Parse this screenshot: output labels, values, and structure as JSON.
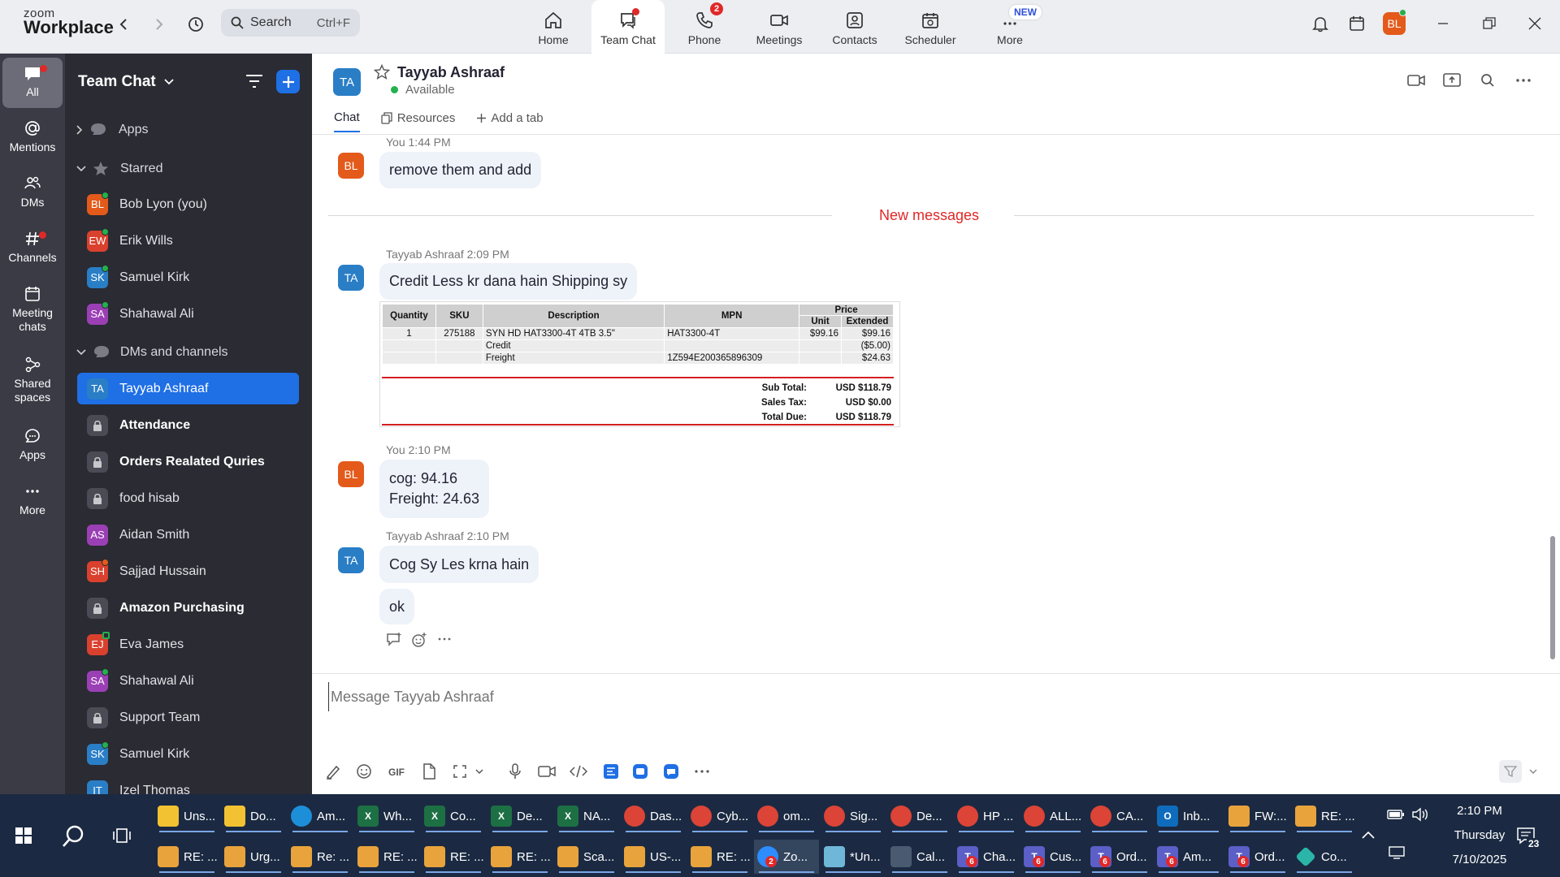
{
  "app": {
    "logo_line1": "zoom",
    "logo_line2": "Workplace"
  },
  "search": {
    "label": "Search",
    "shortcut": "Ctrl+F"
  },
  "tabs": [
    {
      "label": "Home"
    },
    {
      "label": "Team Chat"
    },
    {
      "label": "Phone",
      "badge": "2"
    },
    {
      "label": "Meetings"
    },
    {
      "label": "Contacts"
    },
    {
      "label": "Scheduler"
    },
    {
      "label": "More",
      "tag": "NEW"
    }
  ],
  "user": {
    "initials": "BL"
  },
  "rail": [
    {
      "label": "All"
    },
    {
      "label": "Mentions"
    },
    {
      "label": "DMs"
    },
    {
      "label": "Channels"
    },
    {
      "label": "Meeting chats"
    },
    {
      "label": "Shared spaces"
    },
    {
      "label": "Apps"
    },
    {
      "label": "More"
    }
  ],
  "sidebar": {
    "title": "Team Chat",
    "sections": {
      "apps": "Apps",
      "starred": "Starred",
      "dms": "DMs and channels"
    },
    "starred": [
      {
        "initials": "BL",
        "name": "Bob Lyon (you)"
      },
      {
        "initials": "EW",
        "name": "Erik Wills"
      },
      {
        "initials": "SK",
        "name": "Samuel Kirk"
      },
      {
        "initials": "SA",
        "name": "Shahawal Ali"
      }
    ],
    "channels": [
      {
        "initials": "TA",
        "name": "Tayyab Ashraaf"
      },
      {
        "name": "Attendance"
      },
      {
        "name": "Orders Realated Quries"
      },
      {
        "name": "food hisab"
      },
      {
        "initials": "AS",
        "name": "Aidan Smith"
      },
      {
        "initials": "SH",
        "name": "Sajjad Hussain"
      },
      {
        "name": "Amazon Purchasing"
      },
      {
        "initials": "EJ",
        "name": "Eva James"
      },
      {
        "initials": "SA",
        "name": "Shahawal Ali"
      },
      {
        "name": "Support Team"
      },
      {
        "initials": "SK",
        "name": "Samuel Kirk"
      },
      {
        "initials": "IT",
        "name": "Izel Thomas"
      }
    ]
  },
  "chat": {
    "contact_initials": "TA",
    "contact_name": "Tayyab Ashraaf",
    "status": "Available",
    "tabs": {
      "chat": "Chat",
      "resources": "Resources",
      "add": "Add a tab"
    },
    "new_messages": "New messages",
    "composer_placeholder": "Message Tayyab Ashraaf",
    "messages": [
      {
        "initials": "BL",
        "meta": "You 1:44 PM",
        "lines": [
          "remove them and add"
        ]
      },
      {
        "initials": "TA",
        "meta": "Tayyab Ashraaf 2:09 PM",
        "lines": [
          "Credit Less kr dana hain Shipping sy"
        ]
      },
      {
        "initials": "BL",
        "meta": "You 2:10 PM",
        "lines": [
          "cog: 94.16",
          "Freight: 24.63"
        ]
      },
      {
        "initials": "TA",
        "meta": "Tayyab Ashraaf 2:10 PM",
        "lines": [
          "Cog Sy Les krna hain"
        ]
      },
      {
        "lines": [
          "ok"
        ]
      }
    ],
    "invoice": {
      "headers": {
        "qty": "Quantity",
        "sku": "SKU",
        "desc": "Description",
        "mpn": "MPN",
        "price": "Price",
        "unit": "Unit",
        "ext": "Extended"
      },
      "rows": [
        {
          "qty": "1",
          "sku": "275188",
          "desc": "SYN HD HAT3300-4T 4TB 3.5\"",
          "mpn": "HAT3300-4T",
          "unit": "$99.16",
          "ext": "$99.16"
        },
        {
          "qty": "",
          "sku": "",
          "desc": "Credit",
          "mpn": "",
          "unit": "",
          "ext": "($5.00)"
        },
        {
          "qty": "",
          "sku": "",
          "desc": "Freight",
          "mpn": "1Z594E200365896309",
          "unit": "",
          "ext": "$24.63"
        }
      ],
      "totals": [
        {
          "label": "Sub Total:",
          "value": "USD $118.79"
        },
        {
          "label": "Sales Tax:",
          "value": "USD $0.00"
        },
        {
          "label": "Total Due:",
          "value": "USD $118.79"
        }
      ]
    }
  },
  "taskbar": {
    "row1": [
      "Uns...",
      "Do...",
      "Am...",
      "Wh...",
      "Co...",
      "De...",
      "NA...",
      "Das...",
      "Cyb...",
      "om...",
      "Sig...",
      "De...",
      "HP ...",
      "ALL...",
      "CA...",
      "Inb...",
      "FW:...",
      "RE: ..."
    ],
    "row2": [
      "RE: ...",
      "Urg...",
      "Re: ...",
      "RE: ...",
      "RE: ...",
      "RE: ...",
      "Sca...",
      "US-...",
      "RE: ...",
      "Zo...",
      "*Un...",
      "Cal...",
      "Cha...",
      "Cus...",
      "Ord...",
      "Am...",
      "Ord...",
      "Co..."
    ],
    "zoom_badge": "2",
    "teams_badge": "6",
    "time": "2:10 PM",
    "day": "Thursday",
    "date": "7/10/2025",
    "notif_count": "23"
  },
  "colors": {
    "accent": "#1f6fe5",
    "alert": "#e02828",
    "online": "#22b14c"
  }
}
